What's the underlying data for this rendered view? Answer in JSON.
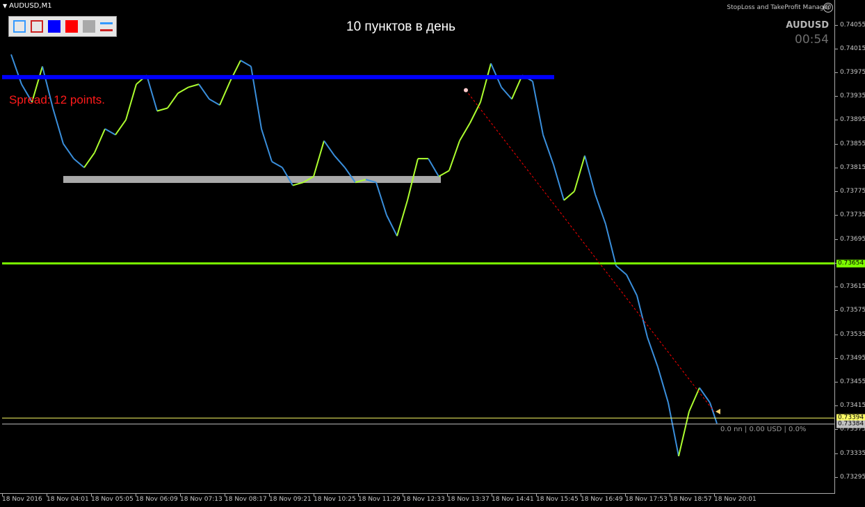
{
  "window": {
    "symbol_title": "AUDUSD,M1",
    "expert_name": "StopLoss and TakeProfit Manager",
    "expert_icon": "smiley-icon"
  },
  "toolbar": {
    "tools": [
      {
        "name": "blue-outline-rect-tool",
        "style": "outline",
        "color": "#3399ff"
      },
      {
        "name": "red-outline-rect-tool",
        "style": "outline",
        "color": "#cc2222"
      },
      {
        "name": "blue-fill-rect-tool",
        "style": "fill",
        "color": "#0000ff"
      },
      {
        "name": "red-fill-rect-tool",
        "style": "fill",
        "color": "#ff0000"
      },
      {
        "name": "gray-fill-rect-tool",
        "style": "fill",
        "color": "#a9a9a9"
      },
      {
        "name": "line-pair-tool",
        "style": "lines",
        "color": "#3399ff",
        "color2": "#cc2222"
      }
    ]
  },
  "overlay": {
    "headline": "10 пунктов в день",
    "symbol": "AUDUSD",
    "timer": "00:54",
    "spread": "Spread: 12 points.",
    "position_info": "0.0 nn | 0.00 USD | 0.0%"
  },
  "colors": {
    "background": "#000000",
    "bull": "#adff2f",
    "bear": "#3a8fdc",
    "resistance": "#0000ff",
    "support_zone": "#a9a9a9",
    "support_line": "#7cfc00",
    "bid_line": "#ffff66",
    "trendline": "#ff0000"
  },
  "chart_data": {
    "type": "line",
    "title": "AUDUSD,M1",
    "ylim": [
      0.73275,
      0.74065
    ],
    "y_ticks": [
      "0.74055",
      "0.74015",
      "0.73975",
      "0.73935",
      "0.73895",
      "0.73855",
      "0.73815",
      "0.73775",
      "0.73735",
      "0.73695",
      "0.73655",
      "0.73615",
      "0.73575",
      "0.73535",
      "0.73495",
      "0.73455",
      "0.73415",
      "0.73375",
      "0.73335",
      "0.73295"
    ],
    "x_ticks": [
      "18 Nov 2016",
      "18 Nov 04:01",
      "18 Nov 05:05",
      "18 Nov 06:09",
      "18 Nov 07:13",
      "18 Nov 08:17",
      "18 Nov 09:21",
      "18 Nov 10:25",
      "18 Nov 11:29",
      "18 Nov 12:33",
      "18 Nov 13:37",
      "18 Nov 14:41",
      "18 Nov 15:45",
      "18 Nov 16:49",
      "18 Nov 17:53",
      "18 Nov 18:57",
      "18 Nov 20:01"
    ],
    "x": [
      "03:10",
      "03:25",
      "03:40",
      "03:55",
      "04:10",
      "04:25",
      "04:40",
      "04:55",
      "05:10",
      "05:25",
      "05:40",
      "05:55",
      "06:10",
      "06:25",
      "06:40",
      "06:55",
      "07:10",
      "07:25",
      "07:40",
      "07:55",
      "08:10",
      "08:25",
      "08:40",
      "08:55",
      "09:10",
      "09:25",
      "09:40",
      "09:55",
      "10:10",
      "10:25",
      "10:40",
      "10:55",
      "11:10",
      "11:25",
      "11:40",
      "11:55",
      "12:10",
      "12:25",
      "12:40",
      "12:55",
      "13:10",
      "13:25",
      "13:40",
      "13:55",
      "14:10",
      "14:25",
      "14:40",
      "14:55",
      "15:10",
      "15:25",
      "15:40",
      "15:55",
      "16:10",
      "16:25",
      "16:40",
      "16:55",
      "17:10",
      "17:25",
      "17:40",
      "17:55",
      "18:10",
      "18:25",
      "18:40",
      "18:55",
      "19:10",
      "19:25",
      "19:40",
      "19:55",
      "20:05"
    ],
    "series": [
      {
        "values": [
          0.74005,
          0.73955,
          0.73925,
          0.73985,
          0.73915,
          0.73855,
          0.7383,
          0.73815,
          0.7384,
          0.7388,
          0.7387,
          0.73895,
          0.73955,
          0.7397,
          0.7391,
          0.73915,
          0.7394,
          0.7395,
          0.73955,
          0.7393,
          0.7392,
          0.7396,
          0.73995,
          0.73985,
          0.7388,
          0.73825,
          0.73815,
          0.73785,
          0.7379,
          0.738,
          0.7386,
          0.73835,
          0.73815,
          0.7379,
          0.73795,
          0.7379,
          0.73735,
          0.737,
          0.7376,
          0.7383,
          0.7383,
          0.738,
          0.7381,
          0.7386,
          0.7389,
          0.73925,
          0.7399,
          0.7395,
          0.7393,
          0.7397,
          0.7396,
          0.7387,
          0.7382,
          0.7376,
          0.73775,
          0.73835,
          0.7377,
          0.7372,
          0.7365,
          0.73635,
          0.736,
          0.7353,
          0.7348,
          0.7342,
          0.7333,
          0.73405,
          0.73445,
          0.7342,
          0.73385
        ]
      }
    ],
    "hlines": [
      {
        "name": "resistance",
        "value": 0.73967
      },
      {
        "name": "support",
        "value": 0.73654
      },
      {
        "name": "bid",
        "value": 0.73394
      },
      {
        "name": "ask",
        "value": 0.73384
      }
    ],
    "zone": {
      "name": "support-zone",
      "value": 0.73795,
      "from": "03:55",
      "to": "13:28"
    },
    "trendline": {
      "from": {
        "x": "14:10",
        "y": 0.73945
      },
      "to": {
        "x": "20:05",
        "y": 0.73405
      }
    },
    "price_tags": [
      {
        "value": "0.73654",
        "color": "#7cfc00"
      },
      {
        "value": "0.73394",
        "color": "#ffff66"
      },
      {
        "value": "0.73384",
        "color": "#c0c0c0"
      }
    ]
  }
}
